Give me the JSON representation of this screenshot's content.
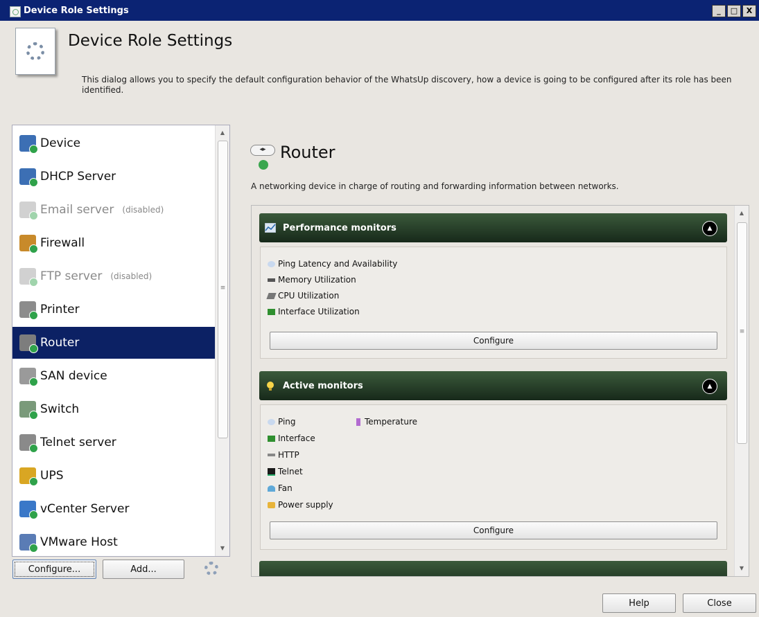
{
  "window": {
    "title": "Device Role Settings",
    "controls": [
      "_",
      "□",
      "X"
    ]
  },
  "header": {
    "title": "Device Role Settings",
    "description": "This dialog allows you to specify the default configuration behavior of the WhatsUp discovery, how a device is going to be configured after its role has been identified."
  },
  "role_list": {
    "items": [
      {
        "label": "Device",
        "icon": "device-icon",
        "disabled": false,
        "selected": false
      },
      {
        "label": "DHCP Server",
        "icon": "dhcp-server-icon",
        "disabled": false,
        "selected": false
      },
      {
        "label": "Email server",
        "icon": "email-server-icon",
        "disabled": true,
        "selected": false
      },
      {
        "label": "Firewall",
        "icon": "firewall-icon",
        "disabled": false,
        "selected": false
      },
      {
        "label": "FTP server",
        "icon": "ftp-server-icon",
        "disabled": true,
        "selected": false
      },
      {
        "label": "Printer",
        "icon": "printer-icon",
        "disabled": false,
        "selected": false
      },
      {
        "label": "Router",
        "icon": "router-icon",
        "disabled": false,
        "selected": true
      },
      {
        "label": "SAN device",
        "icon": "san-device-icon",
        "disabled": false,
        "selected": false
      },
      {
        "label": "Switch",
        "icon": "switch-icon",
        "disabled": false,
        "selected": false
      },
      {
        "label": "Telnet server",
        "icon": "telnet-server-icon",
        "disabled": false,
        "selected": false
      },
      {
        "label": "UPS",
        "icon": "ups-icon",
        "disabled": false,
        "selected": false
      },
      {
        "label": "vCenter Server",
        "icon": "vcenter-server-icon",
        "disabled": false,
        "selected": false
      },
      {
        "label": "VMware Host",
        "icon": "vmware-host-icon",
        "disabled": false,
        "selected": false
      }
    ],
    "disabled_suffix": "(disabled)"
  },
  "list_buttons": {
    "configure": "Configure...",
    "add": "Add..."
  },
  "detail": {
    "title": "Router",
    "description": "A networking device in charge of routing and forwarding information between networks."
  },
  "sections": {
    "performance": {
      "title": "Performance monitors",
      "items": [
        "Ping Latency and Availability",
        "Memory Utilization",
        "CPU Utilization",
        "Interface Utilization"
      ],
      "configure_label": "Configure"
    },
    "active": {
      "title": "Active monitors",
      "col1": [
        "Ping",
        "Interface",
        "HTTP",
        "Telnet",
        "Fan",
        "Power supply"
      ],
      "col2": [
        "Temperature"
      ],
      "configure_label": "Configure"
    }
  },
  "footer": {
    "help": "Help",
    "close": "Close"
  },
  "colors": {
    "titlebar": "#0b2373",
    "selection": "#0c2164",
    "section_header": "#1f3420",
    "status_green": "#2fa24a"
  }
}
